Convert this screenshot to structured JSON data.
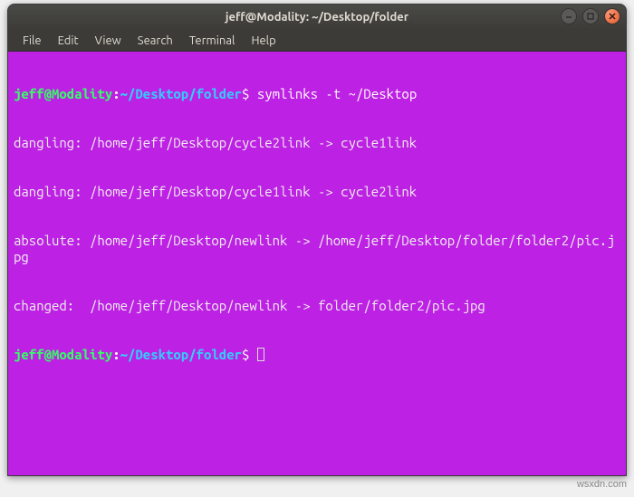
{
  "window": {
    "title": "jeff@Modality: ~/Desktop/folder"
  },
  "menubar": {
    "items": [
      "File",
      "Edit",
      "View",
      "Search",
      "Terminal",
      "Help"
    ]
  },
  "prompt": {
    "user_host": "jeff@Modality",
    "colon": ":",
    "path": "~/Desktop/folder",
    "dollar": "$"
  },
  "terminal": {
    "command": "symlinks -t ~/Desktop",
    "output_lines": [
      "dangling: /home/jeff/Desktop/cycle2link -> cycle1link",
      "dangling: /home/jeff/Desktop/cycle1link -> cycle2link",
      "absolute: /home/jeff/Desktop/newlink -> /home/jeff/Desktop/folder/folder2/pic.jpg",
      "changed:  /home/jeff/Desktop/newlink -> folder/folder2/pic.jpg"
    ]
  },
  "watermark": "wsxdn.com"
}
